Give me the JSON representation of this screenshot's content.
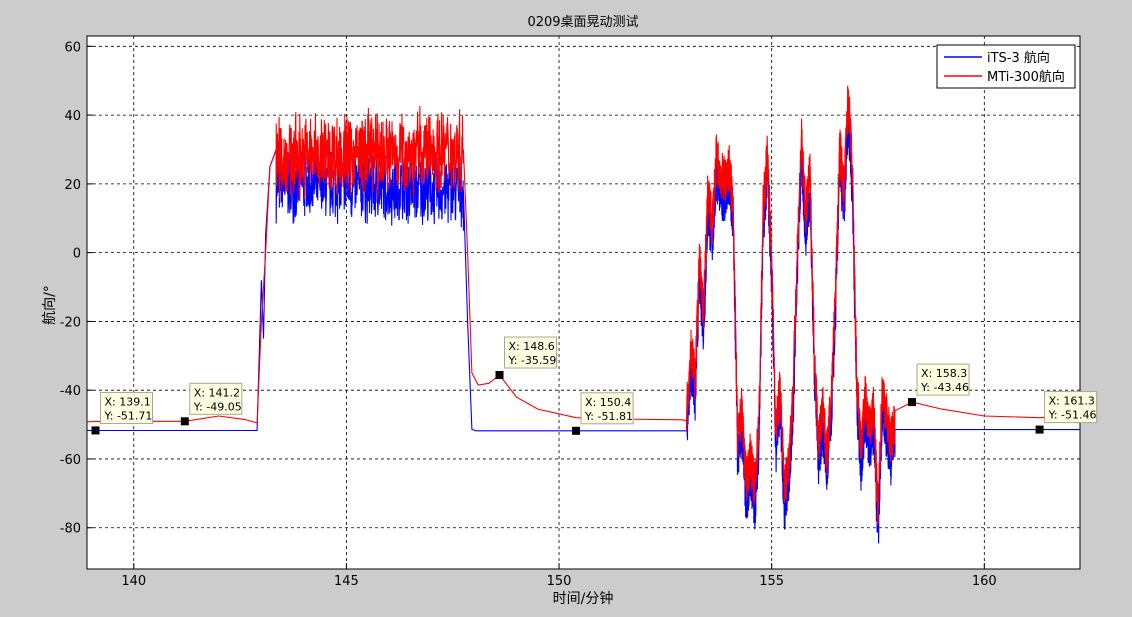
{
  "chart_data": {
    "type": "line",
    "title": "0209桌面晃动测试",
    "xlabel": "时间/分钟",
    "ylabel": "航向/°",
    "xlim": [
      138.9,
      162.25
    ],
    "ylim": [
      -92,
      63
    ],
    "xticks": [
      140,
      145,
      150,
      155,
      160
    ],
    "yticks": [
      -80,
      -60,
      -40,
      -20,
      0,
      20,
      40,
      60
    ],
    "grid": true,
    "legend_position": "top-right",
    "series": [
      {
        "name": "iTS-3 航向",
        "color": "#0000ff",
        "segments": [
          {
            "type": "flat",
            "x": [
              138.9,
              142.9
            ],
            "y": -51.71
          },
          {
            "type": "line",
            "points": [
              [
                142.9,
                -51.5
              ],
              [
                142.95,
                -30
              ],
              [
                143.0,
                -8
              ],
              [
                143.05,
                -25
              ],
              [
                143.1,
                5
              ],
              [
                143.2,
                25
              ],
              [
                143.35,
                30
              ]
            ]
          },
          {
            "type": "noise",
            "x": [
              143.35,
              147.75
            ],
            "base": 20,
            "amp": 12,
            "base_end": 18
          },
          {
            "type": "line",
            "points": [
              [
                147.75,
                18
              ],
              [
                147.85,
                -20
              ],
              [
                147.95,
                -51.4
              ],
              [
                148.05,
                -51.81
              ]
            ]
          },
          {
            "type": "flat",
            "x": [
              148.05,
              153.0
            ],
            "y": -51.81
          }
        ]
      },
      {
        "name": "MTi-300航向",
        "color": "#ff0000",
        "segments": [
          {
            "type": "points",
            "points": [
              [
                138.9,
                -49.2
              ],
              [
                139.1,
                -49.1
              ],
              [
                140.0,
                -49.05
              ],
              [
                141.2,
                -49.05
              ],
              [
                142.0,
                -47.5
              ],
              [
                142.6,
                -48.5
              ],
              [
                142.9,
                -49.5
              ]
            ]
          },
          {
            "type": "line",
            "points": [
              [
                142.9,
                -49.5
              ],
              [
                143.0,
                -20
              ],
              [
                143.1,
                0
              ],
              [
                143.2,
                25
              ],
              [
                143.35,
                30
              ]
            ]
          },
          {
            "type": "noise",
            "x": [
              143.35,
              147.75
            ],
            "base": 28,
            "amp": 14,
            "base_end": 30
          },
          {
            "type": "points",
            "points": [
              [
                147.75,
                30
              ],
              [
                147.85,
                0
              ],
              [
                147.95,
                -35
              ],
              [
                148.1,
                -38.5
              ],
              [
                148.35,
                -38
              ],
              [
                148.6,
                -35.59
              ],
              [
                149.0,
                -42
              ],
              [
                149.5,
                -45.5
              ],
              [
                150.4,
                -48
              ],
              [
                151.5,
                -48.4
              ],
              [
                152.9,
                -48.6
              ]
            ]
          }
        ]
      }
    ],
    "data_tips": [
      {
        "x": 139.1,
        "y": -51.71,
        "label_x": "X: 139.1",
        "label_y": "Y: -51.71"
      },
      {
        "x": 141.2,
        "y": -49.05,
        "label_x": "X: 141.2",
        "label_y": "Y: -49.05"
      },
      {
        "x": 148.6,
        "y": -35.59,
        "label_x": "X: 148.6",
        "label_y": "Y: -35.59"
      },
      {
        "x": 150.4,
        "y": -51.81,
        "label_x": "X: 150.4",
        "label_y": "Y: -51.81"
      },
      {
        "x": 158.3,
        "y": -43.46,
        "label_x": "X: 158.3",
        "label_y": "Y: -43.46"
      },
      {
        "x": 161.3,
        "y": -51.46,
        "label_x": "X: 161.3",
        "label_y": "Y: -51.46"
      }
    ],
    "shake_envelope": {
      "x": [
        153.0,
        157.9
      ],
      "points": [
        [
          153.0,
          -49
        ],
        [
          153.1,
          -30
        ],
        [
          153.2,
          -40
        ],
        [
          153.3,
          -5
        ],
        [
          153.4,
          -20
        ],
        [
          153.5,
          15
        ],
        [
          153.6,
          5
        ],
        [
          153.7,
          25
        ],
        [
          153.8,
          20
        ],
        [
          153.9,
          18
        ],
        [
          154.0,
          22
        ],
        [
          154.1,
          10
        ],
        [
          154.2,
          -58
        ],
        [
          154.3,
          -48
        ],
        [
          154.4,
          -70
        ],
        [
          154.5,
          -62
        ],
        [
          154.6,
          -72
        ],
        [
          154.7,
          -52
        ],
        [
          154.8,
          10
        ],
        [
          154.9,
          26
        ],
        [
          155.0,
          -5
        ],
        [
          155.1,
          -55
        ],
        [
          155.2,
          -42
        ],
        [
          155.3,
          -72
        ],
        [
          155.4,
          -63
        ],
        [
          155.5,
          -45
        ],
        [
          155.6,
          -3
        ],
        [
          155.7,
          30
        ],
        [
          155.8,
          8
        ],
        [
          155.9,
          20
        ],
        [
          156.0,
          -30
        ],
        [
          156.1,
          -58
        ],
        [
          156.2,
          -48
        ],
        [
          156.3,
          -62
        ],
        [
          156.4,
          -45
        ],
        [
          156.5,
          -15
        ],
        [
          156.6,
          28
        ],
        [
          156.7,
          15
        ],
        [
          156.8,
          43
        ],
        [
          156.9,
          20
        ],
        [
          157.0,
          -40
        ],
        [
          157.1,
          -60
        ],
        [
          157.2,
          -45
        ],
        [
          157.3,
          -55
        ],
        [
          157.4,
          -48
        ],
        [
          157.5,
          -80
        ],
        [
          157.6,
          -42
        ],
        [
          157.7,
          -50
        ],
        [
          157.8,
          -58
        ],
        [
          157.9,
          -51.5
        ]
      ]
    },
    "tail": {
      "blue": {
        "x": [
          157.9,
          162.25
        ],
        "y": -51.46
      },
      "red": [
        [
          157.9,
          -46
        ],
        [
          158.3,
          -43.46
        ],
        [
          159.0,
          -45.5
        ],
        [
          160.0,
          -47.5
        ],
        [
          161.3,
          -48
        ],
        [
          162.25,
          -47.4
        ]
      ]
    }
  }
}
